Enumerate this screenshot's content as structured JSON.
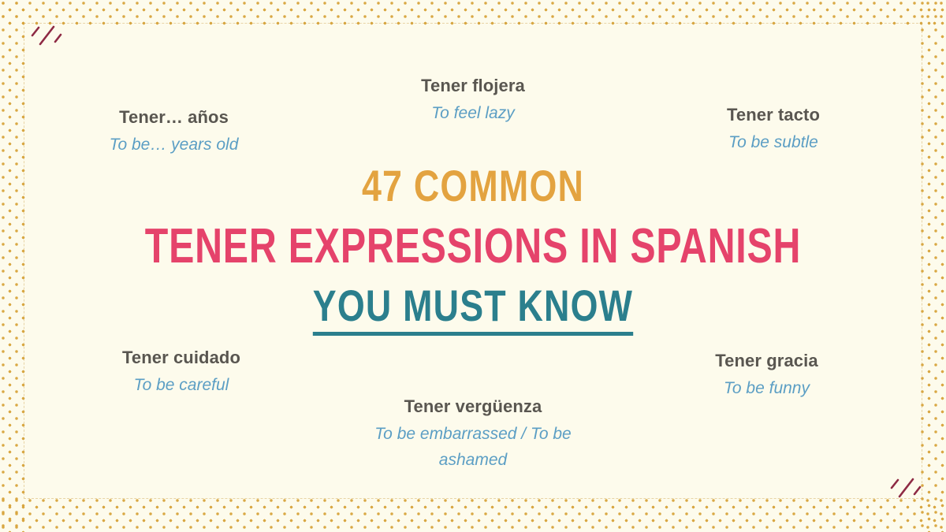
{
  "slide": {
    "background_color": "#FDFBEC",
    "dot_color": "#D8A43C",
    "frame_color": "#CDA046"
  },
  "headline": {
    "line1": "47 Common",
    "line1_color": "#E3A340",
    "line2": "Tener Expressions in Spanish",
    "line2_color": "#E5436B",
    "line3": "You Must Know",
    "line3_color": "#2B7F8D",
    "count": "47"
  },
  "style": {
    "term_color": "#595650",
    "gloss_color": "#5B9EC4"
  },
  "ornaments": [
    {
      "name": "slash-ornament-top-left",
      "color": "#8E2A44",
      "position": "top-left"
    },
    {
      "name": "slash-ornament-bottom-right",
      "color": "#8E2A44",
      "position": "bottom-right"
    }
  ],
  "entries": [
    {
      "id": "anos",
      "term": "Tener… años",
      "gloss": "To be… years old"
    },
    {
      "id": "flojera",
      "term": "Tener flojera",
      "gloss": "To feel lazy"
    },
    {
      "id": "tacto",
      "term": "Tener tacto",
      "gloss": "To be subtle"
    },
    {
      "id": "cuidado",
      "term": "Tener cuidado",
      "gloss": "To be careful"
    },
    {
      "id": "gracia",
      "term": "Tener gracia",
      "gloss": "To be funny"
    },
    {
      "id": "verguenza",
      "term": "Tener vergüenza",
      "gloss": "To be embarrassed / To be ashamed"
    }
  ]
}
